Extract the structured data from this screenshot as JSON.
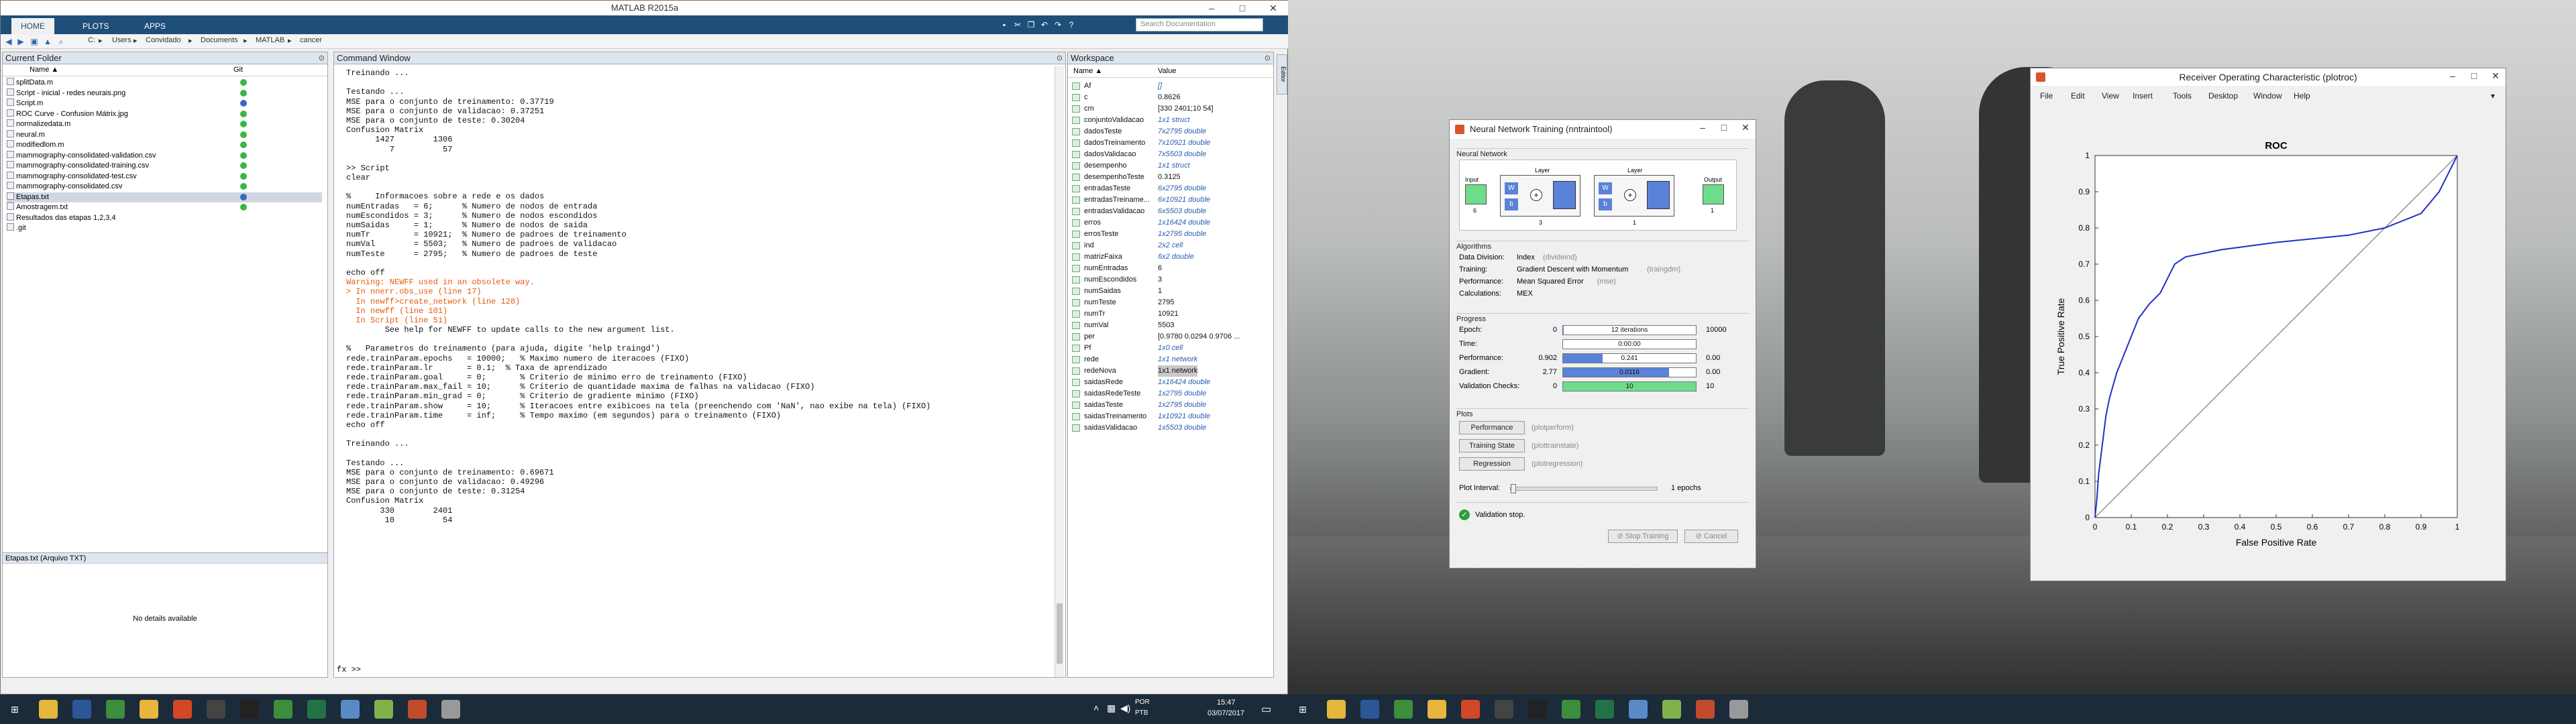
{
  "matlab": {
    "title": "MATLAB R2015a",
    "ribbon_tabs": [
      "HOME",
      "PLOTS",
      "APPS"
    ],
    "search_placeholder": "Search Documentation",
    "path": [
      "C:",
      "Users",
      "Convidado",
      "Documents",
      "MATLAB",
      "cancer"
    ],
    "current_folder": {
      "title": "Current Folder",
      "col_name": "Name ▲",
      "col_git": "Git",
      "files": [
        {
          "name": "splitData.m",
          "git": "green"
        },
        {
          "name": "Script - inicial - redes neurais.png",
          "git": "green"
        },
        {
          "name": "Script.m",
          "git": "blue"
        },
        {
          "name": "ROC Curve - Confusion Mátrix.jpg",
          "git": "green"
        },
        {
          "name": "normalizedata.m",
          "git": "green"
        },
        {
          "name": "neural.m",
          "git": "green"
        },
        {
          "name": "modifiedlom.m",
          "git": "green"
        },
        {
          "name": "mammography-consolidated-validation.csv",
          "git": "green"
        },
        {
          "name": "mammography-consolidated-training.csv",
          "git": "green"
        },
        {
          "name": "mammography-consolidated-test.csv",
          "git": "green"
        },
        {
          "name": "mammography-consolidated.csv",
          "git": "green"
        },
        {
          "name": "Etapas.txt",
          "git": "blue"
        },
        {
          "name": "Amostragem.txt",
          "git": "green"
        },
        {
          "name": "Resultados das etapas 1,2,3,4",
          "git": ""
        },
        {
          "name": ".git",
          "git": ""
        }
      ],
      "details_title": "Etapas.txt  (Arquivo TXT)",
      "details_text": "No details available"
    },
    "command_window": {
      "title": "Command Window",
      "lines": [
        {
          "t": "Treinando ...",
          "c": ""
        },
        {
          "t": "",
          "c": ""
        },
        {
          "t": "Testando ...",
          "c": ""
        },
        {
          "t": "MSE para o conjunto de treinamento: 0.37719",
          "c": ""
        },
        {
          "t": "MSE para o conjunto de validacao: 0.37251",
          "c": ""
        },
        {
          "t": "MSE para o conjunto de teste: 0.30204",
          "c": ""
        },
        {
          "t": "Confusion Matrix",
          "c": ""
        },
        {
          "t": "      1427        1306",
          "c": ""
        },
        {
          "t": "         7          57",
          "c": ""
        },
        {
          "t": "",
          "c": ""
        },
        {
          "t": ">> Script",
          "c": ""
        },
        {
          "t": "clear",
          "c": ""
        },
        {
          "t": "",
          "c": ""
        },
        {
          "t": "%     Informacoes sobre a rede e os dados",
          "c": ""
        },
        {
          "t": "numEntradas   = 6;      % Numero de nodos de entrada",
          "c": ""
        },
        {
          "t": "numEscondidos = 3;      % Numero de nodos escondidos",
          "c": ""
        },
        {
          "t": "numSaidas     = 1;      % Numero de nodos de saida",
          "c": ""
        },
        {
          "t": "numTr         = 10921;  % Numero de padroes de treinamento",
          "c": ""
        },
        {
          "t": "numVal        = 5503;   % Numero de padroes de validacao",
          "c": ""
        },
        {
          "t": "numTeste      = 2795;   % Numero de padroes de teste",
          "c": ""
        },
        {
          "t": "",
          "c": ""
        },
        {
          "t": "echo off",
          "c": ""
        },
        {
          "t": "Warning: NEWFF used in an obsolete way.",
          "c": "warn"
        },
        {
          "t": "> In nnerr.obs_use (line 17)",
          "c": "warn"
        },
        {
          "t": "  In newff>create_network (line 128)",
          "c": "warn"
        },
        {
          "t": "  In newff (line 101)",
          "c": "warn"
        },
        {
          "t": "  In Script (line 51)",
          "c": "warn"
        },
        {
          "t": "        See help for NEWFF to update calls to the new argument list.",
          "c": ""
        },
        {
          "t": "",
          "c": ""
        },
        {
          "t": "%   Parametros do treinamento (para ajuda, digite 'help traingd')",
          "c": ""
        },
        {
          "t": "rede.trainParam.epochs   = 10000;   % Maximo numero de iteracoes (FIXO)",
          "c": ""
        },
        {
          "t": "rede.trainParam.lr       = 0.1;  % Taxa de aprendizado",
          "c": ""
        },
        {
          "t": "rede.trainParam.goal     = 0;       % Criterio de minimo erro de treinamento (FIXO)",
          "c": ""
        },
        {
          "t": "rede.trainParam.max_fail = 10;      % Criterio de quantidade maxima de falhas na validacao (FIXO)",
          "c": ""
        },
        {
          "t": "rede.trainParam.min_grad = 0;       % Criterio de gradiente minimo (FIXO)",
          "c": ""
        },
        {
          "t": "rede.trainParam.show     = 10;      % Iteracoes entre exibicoes na tela (preenchendo com 'NaN', nao exibe na tela) (FIXO)",
          "c": ""
        },
        {
          "t": "rede.trainParam.time     = inf;     % Tempo maximo (em segundos) para o treinamento (FIXO)",
          "c": ""
        },
        {
          "t": "echo off",
          "c": ""
        },
        {
          "t": "",
          "c": ""
        },
        {
          "t": "Treinando ...",
          "c": ""
        },
        {
          "t": "",
          "c": ""
        },
        {
          "t": "Testando ...",
          "c": ""
        },
        {
          "t": "MSE para o conjunto de treinamento: 0.69671",
          "c": ""
        },
        {
          "t": "MSE para o conjunto de validacao: 0.49296",
          "c": ""
        },
        {
          "t": "MSE para o conjunto de teste: 0.31254",
          "c": ""
        },
        {
          "t": "Confusion Matrix",
          "c": ""
        },
        {
          "t": "       330        2401",
          "c": ""
        },
        {
          "t": "        10          54",
          "c": ""
        }
      ],
      "prompt": "fx >>"
    },
    "workspace": {
      "title": "Workspace",
      "col_name": "Name ▲",
      "col_value": "Value",
      "vars": [
        {
          "n": "Af",
          "v": "[]",
          "i": true
        },
        {
          "n": "c",
          "v": "0.8626",
          "i": false
        },
        {
          "n": "cm",
          "v": "[330 2401;10 54]",
          "i": false
        },
        {
          "n": "conjuntoValidacao",
          "v": "1x1 struct",
          "i": true
        },
        {
          "n": "dadosTeste",
          "v": "7x2795 double",
          "i": true
        },
        {
          "n": "dadosTreinamento",
          "v": "7x10921 double",
          "i": true
        },
        {
          "n": "dadosValidacao",
          "v": "7x5503 double",
          "i": true
        },
        {
          "n": "desempenho",
          "v": "1x1 struct",
          "i": true
        },
        {
          "n": "desempenhoTeste",
          "v": "0.3125",
          "i": false
        },
        {
          "n": "entradasTeste",
          "v": "6x2795 double",
          "i": true
        },
        {
          "n": "entradasTreiname...",
          "v": "6x10921 double",
          "i": true
        },
        {
          "n": "entradasValidacao",
          "v": "6x5503 double",
          "i": true
        },
        {
          "n": "erros",
          "v": "1x16424 double",
          "i": true
        },
        {
          "n": "errosTeste",
          "v": "1x2795 double",
          "i": true
        },
        {
          "n": "ind",
          "v": "2x2 cell",
          "i": true
        },
        {
          "n": "matrizFaixa",
          "v": "6x2 double",
          "i": true
        },
        {
          "n": "numEntradas",
          "v": "6",
          "i": false
        },
        {
          "n": "numEscondidos",
          "v": "3",
          "i": false
        },
        {
          "n": "numSaidas",
          "v": "1",
          "i": false
        },
        {
          "n": "numTeste",
          "v": "2795",
          "i": false
        },
        {
          "n": "numTr",
          "v": "10921",
          "i": false
        },
        {
          "n": "numVal",
          "v": "5503",
          "i": false
        },
        {
          "n": "per",
          "v": "[0.9780 0.0294 0.9706 ...",
          "i": false
        },
        {
          "n": "Pf",
          "v": "1x0 cell",
          "i": true
        },
        {
          "n": "rede",
          "v": "1x1 network",
          "i": true
        },
        {
          "n": "redeNova",
          "v": "1x1 network",
          "i": false
        },
        {
          "n": "saidasRede",
          "v": "1x16424 double",
          "i": true
        },
        {
          "n": "saidasRedeTeste",
          "v": "1x2795 double",
          "i": true
        },
        {
          "n": "saidasTeste",
          "v": "1x2795 double",
          "i": true
        },
        {
          "n": "saidasTreinamento",
          "v": "1x10921 double",
          "i": true
        },
        {
          "n": "saidasValidacao",
          "v": "1x5503 double",
          "i": true
        }
      ]
    }
  },
  "nntool": {
    "title": "Neural Network Training (nntraintool)",
    "section_network": "Neural Network",
    "net": {
      "input": "Input",
      "input_n": "6",
      "hidden": "Layer",
      "hidden_n": "3",
      "out_layer": "Layer",
      "out_n": "1",
      "output": "Output",
      "output_n": "1",
      "w": "W",
      "b": "b"
    },
    "section_algorithms": "Algorithms",
    "algorithms": [
      {
        "k": "Data Division:",
        "v": "Index",
        "h": "(divideind)"
      },
      {
        "k": "Training:",
        "v": "Gradient Descent with Momentum",
        "h": "(traingdm)"
      },
      {
        "k": "Performance:",
        "v": "Mean Squared Error",
        "h": "(mse)"
      },
      {
        "k": "Calculations:",
        "v": "MEX",
        "h": ""
      }
    ],
    "section_progress": "Progress",
    "progress": [
      {
        "k": "Epoch:",
        "l": "0",
        "mid": "12 iterations",
        "r": "10000",
        "f": 0.0012,
        "color": "#5b82d9"
      },
      {
        "k": "Time:",
        "l": "",
        "mid": "0:00:00",
        "r": "",
        "f": 0,
        "color": "#5b82d9"
      },
      {
        "k": "Performance:",
        "l": "0.902",
        "mid": "0.241",
        "r": "0.00",
        "f": 0.3,
        "color": "#5b82d9"
      },
      {
        "k": "Gradient:",
        "l": "2.77",
        "mid": "0.0116",
        "r": "0.00",
        "f": 0.8,
        "color": "#5b82d9"
      },
      {
        "k": "Validation Checks:",
        "l": "0",
        "mid": "10",
        "r": "10",
        "f": 1.0,
        "color": "#6fdc8c"
      }
    ],
    "section_plots": "Plots",
    "plots": [
      {
        "b": "Performance",
        "h": "(plotperform)"
      },
      {
        "b": "Training State",
        "h": "(plottrainstate)"
      },
      {
        "b": "Regression",
        "h": "(plotregression)"
      }
    ],
    "plot_interval_label": "Plot Interval:",
    "plot_interval_value": "1 epochs",
    "status": "Validation stop.",
    "stop_button": "Stop Training",
    "cancel_button": "Cancel"
  },
  "roc": {
    "title": "Receiver Operating Characteristic (plotroc)",
    "menu": [
      "File",
      "Edit",
      "View",
      "Insert",
      "Tools",
      "Desktop",
      "Window",
      "Help"
    ]
  },
  "chart_data": {
    "type": "line",
    "title": "ROC",
    "xlabel": "False Positive Rate",
    "ylabel": "True Positive Rate",
    "xlim": [
      0,
      1
    ],
    "ylim": [
      0,
      1
    ],
    "ticks": [
      "0",
      "0.1",
      "0.2",
      "0.3",
      "0.4",
      "0.5",
      "0.6",
      "0.7",
      "0.8",
      "0.9",
      "1"
    ],
    "series": [
      {
        "values": [
          [
            0,
            0
          ],
          [
            0.005,
            0.05
          ],
          [
            0.01,
            0.12
          ],
          [
            0.02,
            0.2
          ],
          [
            0.03,
            0.28
          ],
          [
            0.04,
            0.33
          ],
          [
            0.06,
            0.4
          ],
          [
            0.08,
            0.45
          ],
          [
            0.1,
            0.5
          ],
          [
            0.12,
            0.55
          ],
          [
            0.15,
            0.59
          ],
          [
            0.18,
            0.62
          ],
          [
            0.2,
            0.66
          ],
          [
            0.22,
            0.7
          ],
          [
            0.25,
            0.72
          ],
          [
            0.3,
            0.73
          ],
          [
            0.35,
            0.74
          ],
          [
            0.5,
            0.76
          ],
          [
            0.7,
            0.78
          ],
          [
            0.8,
            0.8
          ],
          [
            0.9,
            0.84
          ],
          [
            0.95,
            0.9
          ],
          [
            0.98,
            0.96
          ],
          [
            1,
            1
          ]
        ]
      },
      {
        "values": [
          [
            0,
            0
          ],
          [
            1,
            1
          ]
        ]
      }
    ]
  },
  "taskbar": {
    "lang": "POR",
    "kbd": "PTB",
    "time": "15:47",
    "date": "03/07/2017",
    "icons": [
      "windows-start",
      "file-explorer",
      "word",
      "chrome",
      "folder",
      "powerpoint",
      "media",
      "unity",
      "chrome",
      "excel",
      "notepad",
      "paint",
      "matlab",
      "files"
    ]
  }
}
